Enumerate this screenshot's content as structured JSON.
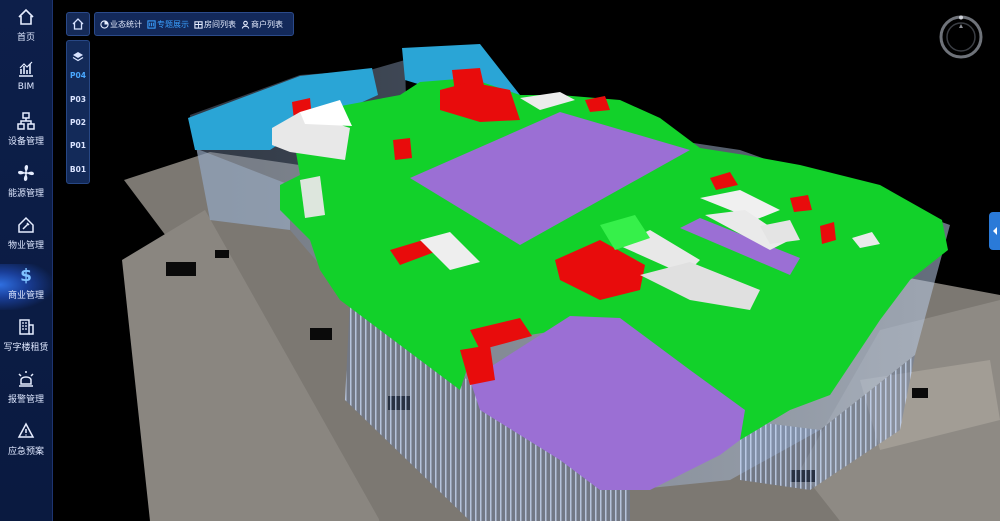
{
  "sidebar": {
    "items": [
      {
        "label": "首页",
        "icon": "home-icon"
      },
      {
        "label": "BIM",
        "icon": "chart-icon"
      },
      {
        "label": "设备管理",
        "icon": "network-icon"
      },
      {
        "label": "能源管理",
        "icon": "fan-icon"
      },
      {
        "label": "物业管理",
        "icon": "house-tool-icon"
      },
      {
        "label": "商业管理",
        "icon": "dollar-icon"
      },
      {
        "label": "写字楼租赁",
        "icon": "building-icon"
      },
      {
        "label": "报警管理",
        "icon": "alarm-icon"
      },
      {
        "label": "应急预案",
        "icon": "warning-icon"
      }
    ],
    "active_index": 5
  },
  "floors": {
    "items": [
      "P04",
      "P03",
      "P02",
      "P01",
      "B01"
    ],
    "active": "P04"
  },
  "tabs": [
    {
      "label": "业态统计",
      "icon": "pie-icon"
    },
    {
      "label": "专题展示",
      "icon": "topic-icon"
    },
    {
      "label": "房间列表",
      "icon": "rooms-icon"
    },
    {
      "label": "商户列表",
      "icon": "person-icon"
    }
  ],
  "active_tab": 1,
  "colors": {
    "sidebar_bg": "#0d1f4a",
    "accent": "#3aa0ff",
    "zone_green": "#12d12a",
    "zone_purple": "#9b6fd4",
    "zone_red": "#e80c0c",
    "zone_blue": "#2aa5d6",
    "zone_white": "#e8e8e8"
  }
}
